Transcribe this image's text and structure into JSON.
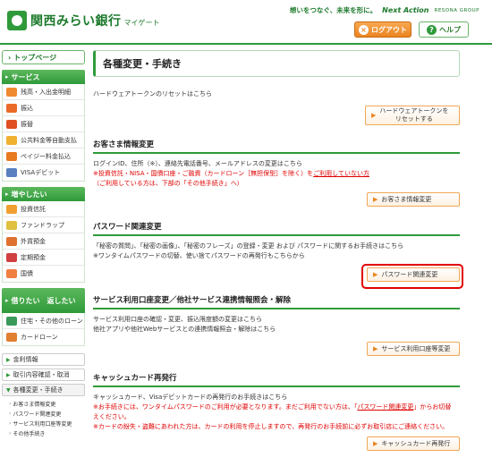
{
  "header": {
    "bank_name": "関西みらい銀行",
    "sub_name": "マイゲート",
    "slogan": "想いをつなぐ、未来を形に。",
    "brand": "Next Action",
    "group": "RESONA GROUP",
    "logout_label": "ログアウト",
    "help_label": "ヘルプ"
  },
  "sidebar": {
    "top_page": "トップページ",
    "sections": [
      {
        "title": "サービス",
        "items": [
          {
            "label": "残高・入出金明細",
            "color": "#f08a30"
          },
          {
            "label": "振込",
            "color": "#ea6a2a"
          },
          {
            "label": "振替",
            "color": "#e05020"
          },
          {
            "label": "公共料金等自動支払",
            "color": "#f0b030"
          },
          {
            "label": "ペイジー料金払込",
            "color": "#e87a20"
          },
          {
            "label": "VISAデビット",
            "color": "#5a80c0"
          }
        ]
      },
      {
        "title": "増やしたい",
        "items": [
          {
            "label": "投資信託",
            "color": "#f0a030"
          },
          {
            "label": "ファンドラップ",
            "color": "#e0c040"
          },
          {
            "label": "外貨預金",
            "color": "#e07030"
          },
          {
            "label": "定期預金",
            "color": "#d04040"
          },
          {
            "label": "国債",
            "color": "#f08040"
          }
        ]
      },
      {
        "title": "借りたい　返したい",
        "items": [
          {
            "label": "住宅・その他のローン",
            "color": "#3a9a5a"
          },
          {
            "label": "カードローン",
            "color": "#e08030"
          }
        ]
      }
    ],
    "text_menu": [
      {
        "label": "金利情報",
        "open": false
      },
      {
        "label": "取引内容確認・取消",
        "open": false
      },
      {
        "label": "各種変更・手続き",
        "open": true
      }
    ],
    "sub_links": [
      "お客さま情報変更",
      "パスワード関連変更",
      "サービス利用口座等変更",
      "その他手続き"
    ]
  },
  "main": {
    "page_title": "各種変更・手続き",
    "hw_token": {
      "text": "ハードウェアトークンのリセットはこちら",
      "button_line1": "ハードウェアトークンを",
      "button_line2": "リセットする"
    },
    "customer": {
      "title": "お客さま情報変更",
      "line1": "ログインID、住所（※）、連絡先電話番号、メールアドレスの変更はこちら",
      "line2_pre": "※投資信託・NISA・国債口座・ご融資（カードローン［無担保型］を除く）を",
      "line2_link": "ご利用していない方",
      "line3": "（ご利用している方は、下部の「その他手続き」へ）",
      "button": "お客さま情報変更"
    },
    "password": {
      "title": "パスワード関連変更",
      "line1": "「秘密の質問」、「秘密の画像」、「秘密のフレーズ」の登録・変更 および パスワードに関するお手続きはこちら",
      "line2": "※ワンタイムパスワードの切替、使い捨てパスワードの再発行もこちらから",
      "button": "パスワード関連変更"
    },
    "service": {
      "title": "サービス利用口座変更／他社サービス連携情報照会・解除",
      "line1": "サービス利用口座の確認・変更、振込限度額の変更はこちら",
      "line2": "他社アプリや他社Webサービスとの連携情報照会・解除はこちら",
      "button": "サービス利用口座等変更"
    },
    "cash_card": {
      "title": "キャッシュカード再発行",
      "line1": "キャッシュカード、Visaデビットカードの再発行のお手続きはこちら",
      "line2_pre": "※お手続きには、ワンタイムパスワードのご利用が必要となります。まだご利用でない方は、「",
      "line2_link": "パスワード関連変更",
      "line2_post": "」からお切替",
      "line3": "えください。",
      "line4": "※カードの紛失・盗難にあわれた方は、カードの利用を停止しますので、再発行のお手続前に必ずお取引店にご連絡ください。",
      "button": "キャッシュカード再発行"
    }
  },
  "colors": {
    "brand_green": "#2f9a3a",
    "accent_orange": "#ea8522",
    "alert_red": "#e00000"
  }
}
